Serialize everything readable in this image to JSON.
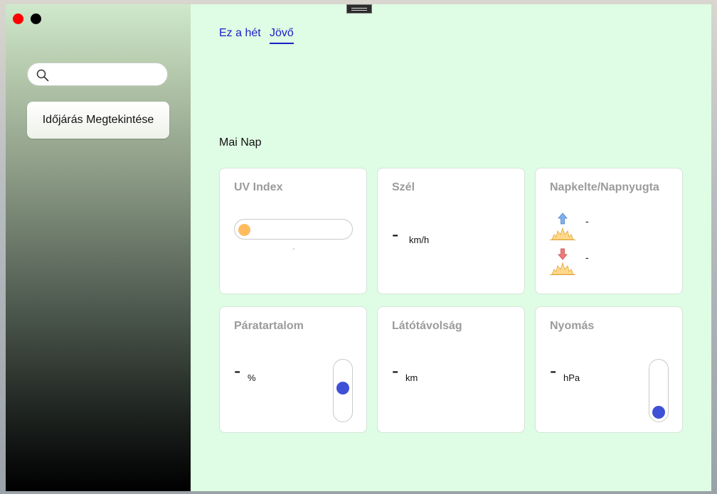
{
  "sidebar": {
    "search": {
      "placeholder": "",
      "value": ""
    },
    "view_button_label": "Időjárás Megtekintése"
  },
  "tabs": [
    {
      "label": "Ez a hét",
      "active": false
    },
    {
      "label": "Jövő",
      "active": true
    }
  ],
  "section_title": "Mai Nap",
  "cards": {
    "uv": {
      "title": "UV Index",
      "level_label": "-"
    },
    "wind": {
      "title": "Szél",
      "value": "-",
      "unit": "km/h"
    },
    "sun": {
      "title": "Napkelte/Napnyugta",
      "sunrise": "-",
      "sunset": "-"
    },
    "humidity": {
      "title": "Páratartalom",
      "value": "-",
      "unit": "%"
    },
    "visibility": {
      "title": "Látótávolság",
      "value": "-",
      "unit": "km"
    },
    "pressure": {
      "title": "Nyomás",
      "value": "-",
      "unit": "hPa"
    }
  },
  "colors": {
    "accent": "#1a21c8",
    "content_background": "#dffce4",
    "uv_indicator": "#ffbc5e",
    "slider_knob": "#3e50d6"
  }
}
